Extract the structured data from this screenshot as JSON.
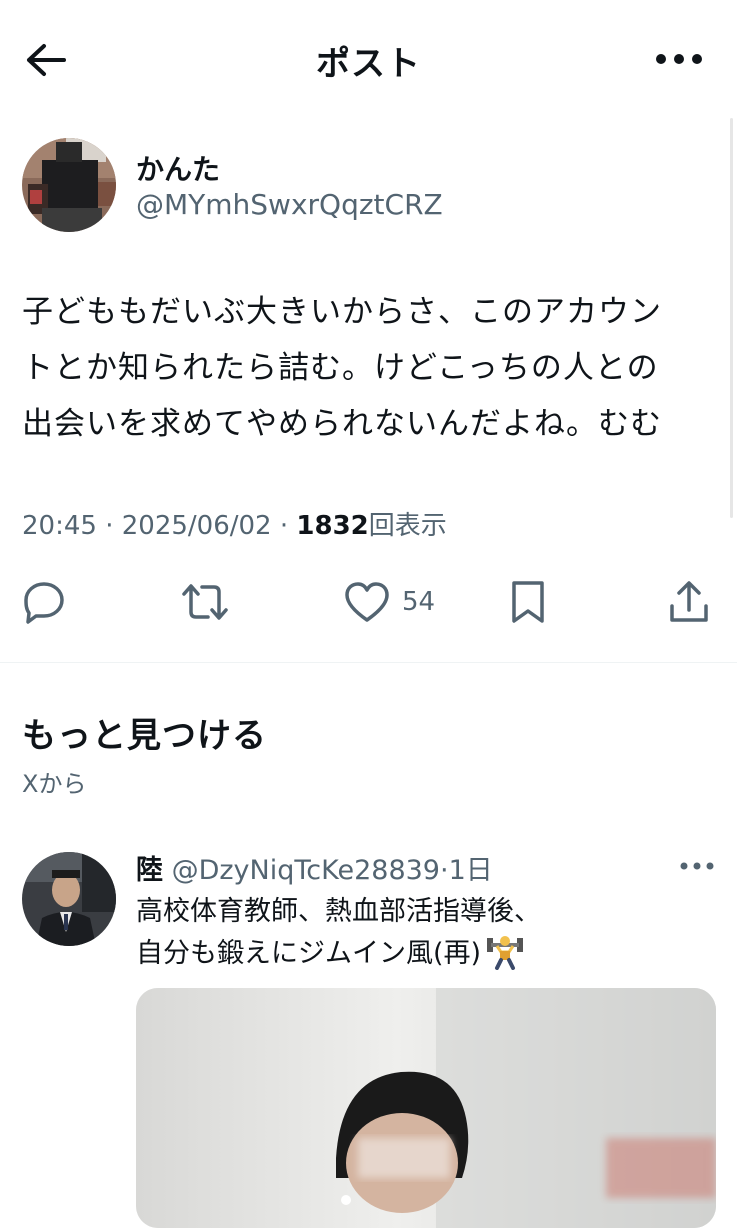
{
  "header": {
    "title": "ポスト",
    "back_icon": "arrow-left-icon",
    "more_icon": "more-horizontal-icon"
  },
  "post": {
    "author_name": "かんた",
    "author_handle": "@MYmhSwxrQqztCRZ",
    "text_lines": [
      "子どももだいぶ大きいからさ、このアカウン",
      "トとか知られたら詰む。けどこっちの人との",
      "出会いを求めてやめられないんだよね。むむ"
    ],
    "time": "20:45",
    "date": "2025/06/02",
    "separator": "·",
    "views_count": "1832",
    "views_label": "回表示",
    "like_count": "54",
    "action_icons": [
      "reply-icon",
      "repost-icon",
      "like-icon",
      "bookmark-icon",
      "share-icon"
    ]
  },
  "discover": {
    "title": "もっと見つける",
    "subtitle": "Xから"
  },
  "recommended": {
    "name": "陸",
    "handle": "@DzyNiqTcKe28839",
    "separator": "·",
    "time": "1日",
    "text_lines": [
      "高校体育教師、熱血部活指導後、",
      "自分も鍛えにジムイン風(再)"
    ],
    "emoji_icon": "weightlifter-icon"
  },
  "colors": {
    "text_primary": "#0f1419",
    "text_secondary": "#536471",
    "divider": "#eff3f4",
    "background": "#ffffff"
  }
}
